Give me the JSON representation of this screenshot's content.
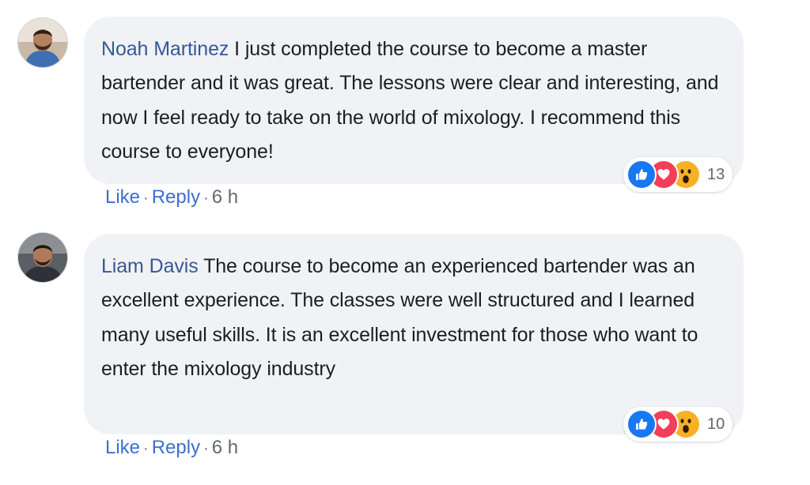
{
  "comments": [
    {
      "author": "Noah Martinez",
      "text": "I just completed the course to become a master bartender and it was great. The lessons were clear and interesting, and now I feel ready to take on the world of mixology. I recommend this course to everyone!",
      "reactions": {
        "icons": [
          "like-icon",
          "love-icon",
          "wow-icon"
        ],
        "count": "13"
      },
      "actions": {
        "like": "Like",
        "reply": "Reply",
        "separator": "·",
        "time": "6 h"
      }
    },
    {
      "author": "Liam Davis",
      "text": "The course to become an experienced bartender was an excellent experience. The classes were well structured and I learned many useful skills. It is an excellent investment for those who want to enter the mixology industry",
      "reactions": {
        "icons": [
          "like-icon",
          "love-icon",
          "wow-icon"
        ],
        "count": "10"
      },
      "actions": {
        "like": "Like",
        "reply": "Reply",
        "separator": "·",
        "time": "6 h"
      }
    }
  ],
  "colors": {
    "bubble": "#f0f2f5",
    "author": "#385898",
    "link": "#3b6fd0",
    "like": "#1877f2",
    "love": "#f33e58",
    "wow": "#f7b125"
  }
}
